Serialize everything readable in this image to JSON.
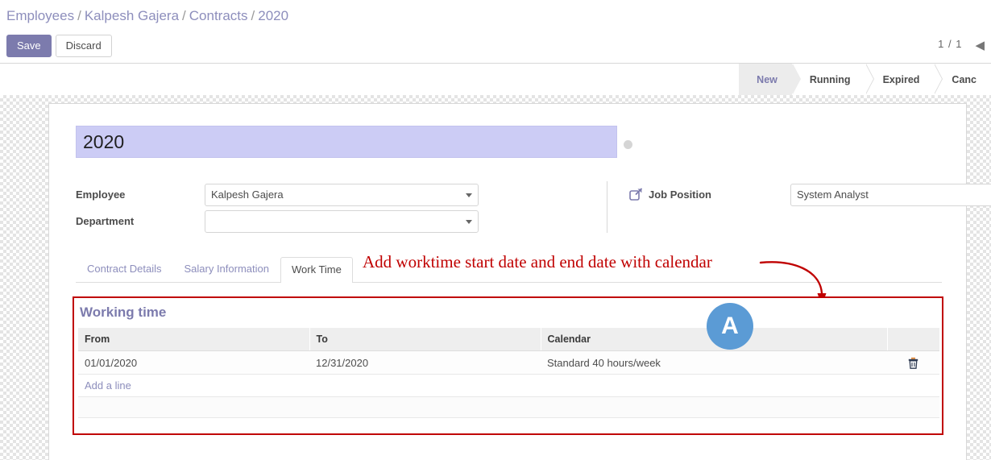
{
  "breadcrumb": {
    "items": [
      "Employees",
      "Kalpesh Gajera",
      "Contracts",
      "2020"
    ],
    "separator": "/"
  },
  "toolbar": {
    "save_label": "Save",
    "discard_label": "Discard"
  },
  "pager": {
    "count": "1 / 1",
    "prev_icon": "chevron-left-icon",
    "prev_glyph": "◀"
  },
  "statusbar": {
    "stages": [
      {
        "label": "New",
        "active": true
      },
      {
        "label": "Running",
        "active": false
      },
      {
        "label": "Expired",
        "active": false
      },
      {
        "label": "Canc",
        "active": false
      }
    ]
  },
  "form": {
    "title_value": "2020",
    "fields": {
      "employee_label": "Employee",
      "employee_value": "Kalpesh Gajera",
      "department_label": "Department",
      "department_value": "",
      "job_position_label": "Job Position",
      "job_position_value": "System Analyst"
    },
    "icons": {
      "job_position_internal_link": "external-link-icon",
      "job_position_open": "external-link-icon"
    }
  },
  "notebook": {
    "tabs": [
      {
        "label": "Contract Details",
        "active": false
      },
      {
        "label": "Salary Information",
        "active": false
      },
      {
        "label": "Work Time",
        "active": true
      }
    ]
  },
  "working_time": {
    "title": "Working time",
    "columns": [
      "From",
      "To",
      "Calendar",
      ""
    ],
    "rows": [
      {
        "from": "01/01/2020",
        "to": "12/31/2020",
        "calendar": "Standard 40 hours/week",
        "delete_icon": "trash-icon"
      }
    ],
    "add_line_label": "Add a line"
  },
  "annotations": {
    "text": "Add worktime start date and end date with calendar",
    "marker_label": "A",
    "arrow_icon": "curved-arrow-icon",
    "colors": {
      "annotation_red": "#c00000",
      "marker_blue": "#5b9bd5",
      "odoo_purple": "#7c7bad",
      "link_purple": "#8d8ebc",
      "title_highlight": "#ccccf5"
    }
  }
}
